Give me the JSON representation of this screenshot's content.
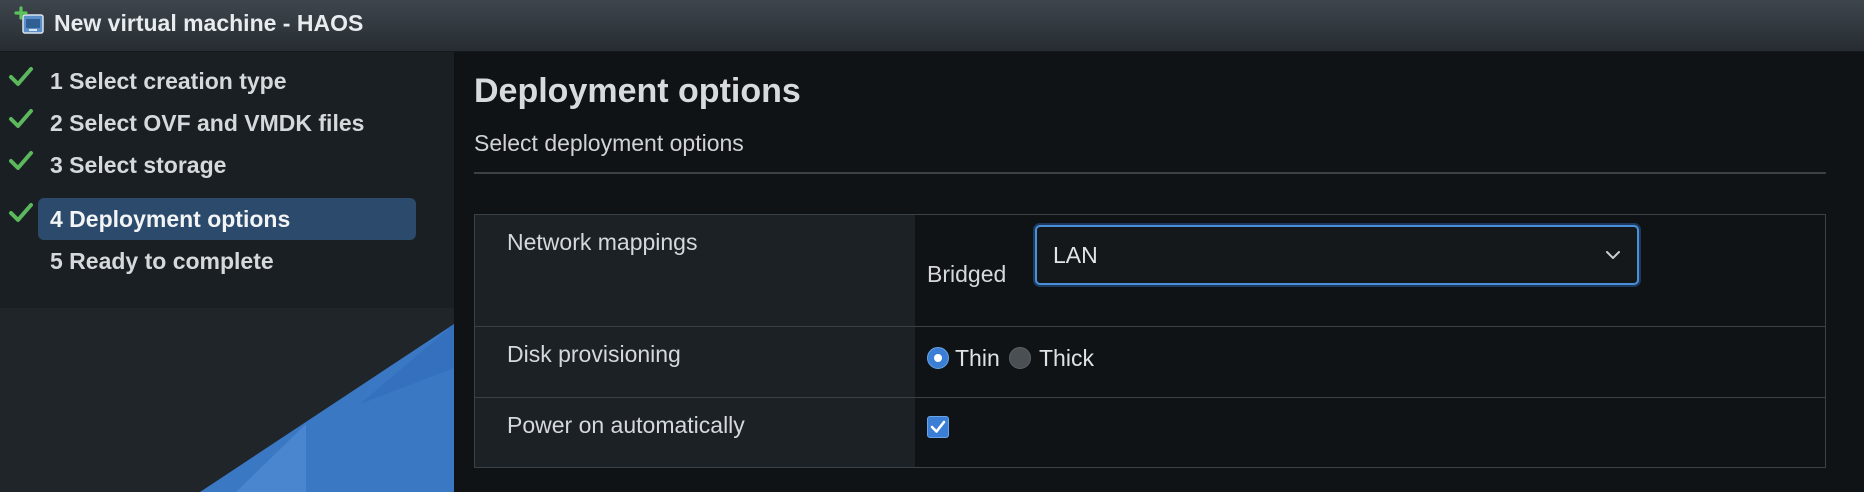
{
  "window": {
    "title": "New virtual machine - HAOS",
    "icon": "vm-add-icon"
  },
  "sidebar": {
    "steps": [
      {
        "label": "1 Select creation type",
        "completed": true,
        "active": false
      },
      {
        "label": "2 Select OVF and VMDK files",
        "completed": true,
        "active": false
      },
      {
        "label": "3 Select storage",
        "completed": true,
        "active": false
      },
      {
        "label": "4 Deployment options",
        "completed": true,
        "active": true
      },
      {
        "label": "5 Ready to complete",
        "completed": false,
        "active": false
      }
    ]
  },
  "main": {
    "title": "Deployment options",
    "subtitle": "Select deployment options",
    "network_mappings": {
      "label": "Network mappings",
      "network_name": "Bridged",
      "selected": "LAN"
    },
    "disk_provisioning": {
      "label": "Disk provisioning",
      "options": [
        "Thin",
        "Thick"
      ],
      "selected": "Thin"
    },
    "power_on": {
      "label": "Power on automatically",
      "checked": true
    }
  },
  "colors": {
    "accent": "#3a7fd5",
    "active_step_bg": "#2c4a6b",
    "check_green": "#5cb85c"
  }
}
